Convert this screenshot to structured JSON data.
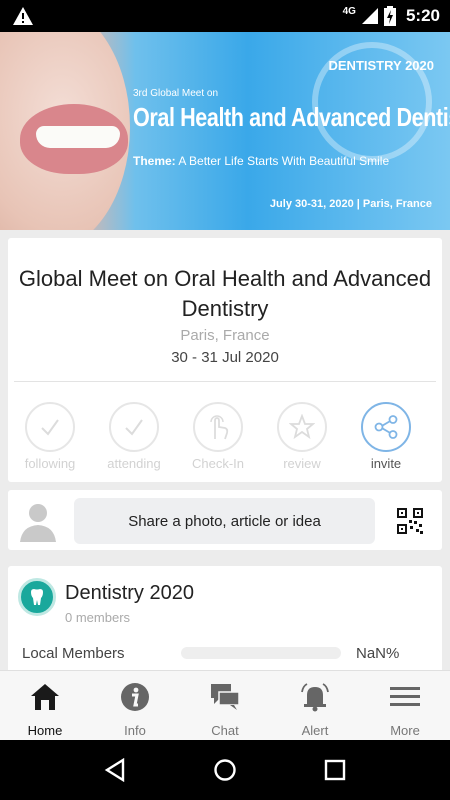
{
  "status_bar": {
    "network": "4G",
    "time": "5:20"
  },
  "banner": {
    "edition": "3rd Global Meet on",
    "title": "Oral Health and Advanced Dentistry",
    "badge": "DENTISTRY 2020",
    "theme_label": "Theme:",
    "theme_text": "A Better Life Starts With Beautiful Smile",
    "dates_place": "July 30-31, 2020 | Paris, France"
  },
  "event": {
    "title": "Global Meet on Oral Health and Advanced Dentistry",
    "location": "Paris, France",
    "dates": "30 - 31 Jul 2020",
    "actions": [
      {
        "label": "following",
        "icon": "check-icon",
        "active": false
      },
      {
        "label": "attending",
        "icon": "check-icon",
        "active": false
      },
      {
        "label": "Check-In",
        "icon": "tap-icon",
        "active": false
      },
      {
        "label": "review",
        "icon": "star-icon",
        "active": false
      },
      {
        "label": "invite",
        "icon": "share-icon",
        "active": true
      }
    ]
  },
  "share": {
    "prompt": "Share a photo, article or idea"
  },
  "group": {
    "name": "Dentistry 2020",
    "members": "0 members",
    "local_label": "Local Members",
    "local_value": "NaN%",
    "local_fraction": 0
  },
  "tabs": [
    {
      "label": "Home",
      "icon": "home-icon",
      "active": true
    },
    {
      "label": "Info",
      "icon": "info-icon",
      "active": false
    },
    {
      "label": "Chat",
      "icon": "chat-icon",
      "active": false
    },
    {
      "label": "Alert",
      "icon": "bell-icon",
      "active": false
    },
    {
      "label": "More",
      "icon": "menu-icon",
      "active": false
    }
  ],
  "colors": {
    "accent": "#7fb5e6",
    "teal": "#1aa89c",
    "banner_blue": "#3aa8e9"
  }
}
